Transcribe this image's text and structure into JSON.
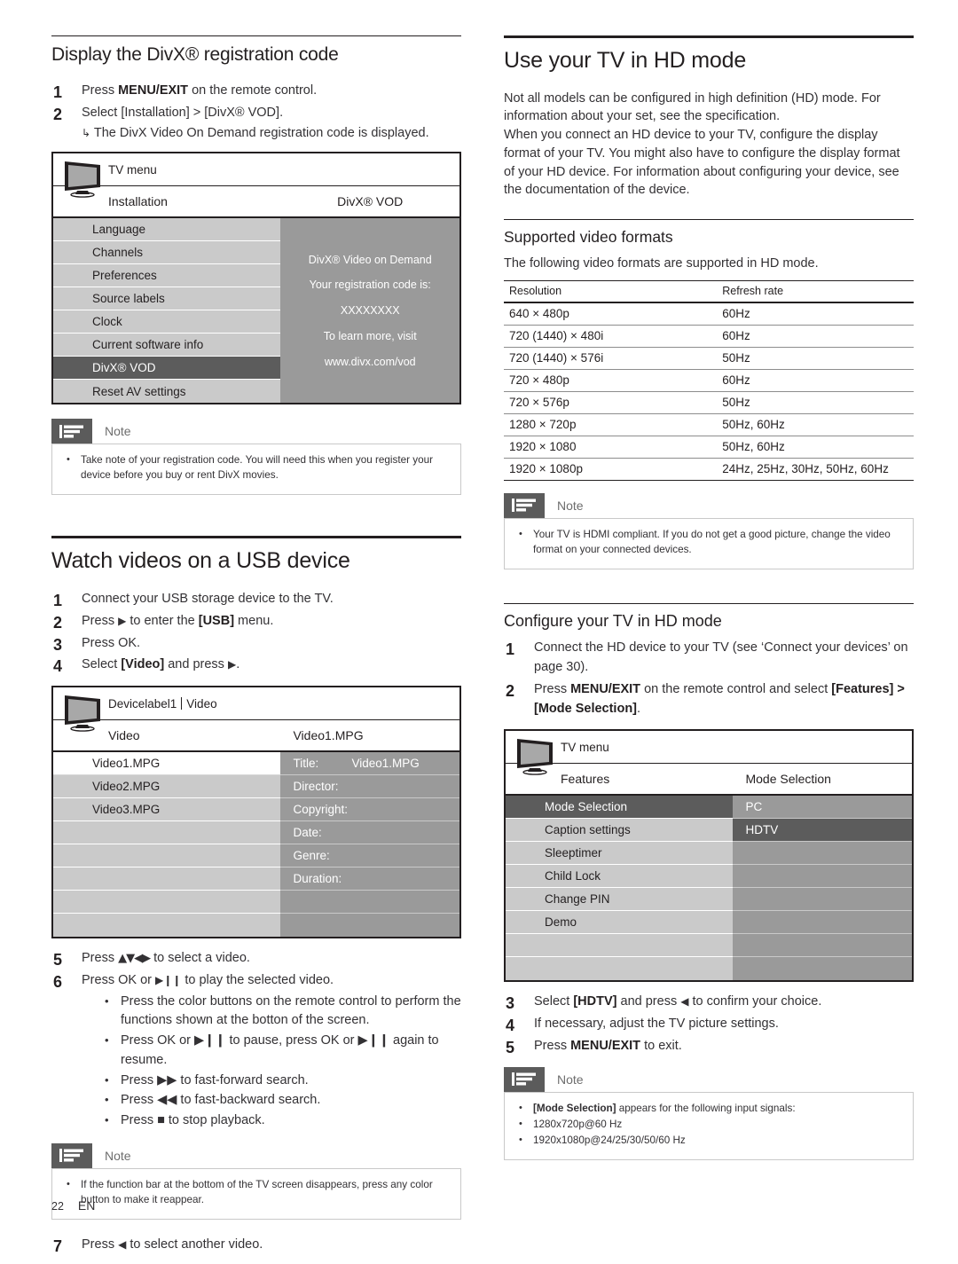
{
  "left": {
    "divx": {
      "heading": "Display the DivX® registration code",
      "steps": [
        {
          "num": "1",
          "text_before": "Press ",
          "bold": "MENU/EXIT",
          "text_after": " on the remote control."
        },
        {
          "num": "2",
          "text_before": "Select ",
          "bold": "[Installation] > [DivX® VOD]",
          "text_after": "."
        }
      ],
      "substep": "The DivX Video On Demand registration code is displayed.",
      "menu": {
        "titlebar": "TV menu",
        "col1_header": "Installation",
        "col2_header": "DivX® VOD",
        "items": [
          {
            "label": "Language",
            "selected": false
          },
          {
            "label": "Channels",
            "selected": false
          },
          {
            "label": "Preferences",
            "selected": false
          },
          {
            "label": "Source labels",
            "selected": false
          },
          {
            "label": "Clock",
            "selected": false
          },
          {
            "label": "Current software info",
            "selected": false
          },
          {
            "label": "DivX® VOD",
            "selected": true
          },
          {
            "label": "Reset AV settings",
            "selected": false
          }
        ],
        "panel_lines": [
          "DivX® Video on Demand",
          "Your registration code is: XXXXXXXX",
          "To learn more, visit www.divx.com/vod"
        ]
      },
      "note": {
        "label": "Note",
        "bullets": [
          "Take note of your registration code. You will need this when you register your device before you buy or rent DivX movies."
        ]
      }
    },
    "usb": {
      "heading": "Watch videos on a USB device",
      "steps": [
        {
          "num": "1",
          "text": "Connect your USB storage device to the TV."
        },
        {
          "num": "2",
          "text_before": "Press ",
          "glyph": "▶",
          "text_mid": " to enter the ",
          "bold": "[USB]",
          "text_after": " menu."
        },
        {
          "num": "3",
          "text_before": "Press ",
          "bold": "OK",
          "text_after": "."
        },
        {
          "num": "4",
          "text_before": "Select ",
          "bold": "[Video]",
          "text_mid": " and press ",
          "glyph": "▶",
          "text_after": "."
        }
      ],
      "menu": {
        "titlebar_device": "Devicelabel1",
        "titlebar_section": "Video",
        "col1_header": "Video",
        "col2_header": "Video1.MPG",
        "items": [
          {
            "label": "Video1.MPG",
            "highlight": true
          },
          {
            "label": "Video2.MPG",
            "highlight": false
          },
          {
            "label": "Video3.MPG",
            "highlight": false
          },
          {
            "label": "",
            "highlight": false
          },
          {
            "label": "",
            "highlight": false
          },
          {
            "label": "",
            "highlight": false
          },
          {
            "label": "",
            "highlight": false
          },
          {
            "label": "",
            "highlight": false
          }
        ],
        "details": [
          {
            "key": "Title:",
            "value": "Video1.MPG"
          },
          {
            "key": "Director:",
            "value": ""
          },
          {
            "key": "Copyright:",
            "value": ""
          },
          {
            "key": "Date:",
            "value": ""
          },
          {
            "key": "Genre:",
            "value": ""
          },
          {
            "key": "Duration:",
            "value": ""
          },
          {
            "key": "",
            "value": ""
          },
          {
            "key": "",
            "value": ""
          }
        ]
      },
      "steps2": [
        {
          "num": "5",
          "text_before": "Press ",
          "glyph": "▲▼◀▶",
          "text_after": " to select a video."
        },
        {
          "num": "6",
          "text_before": "Press ",
          "bold": "OK",
          "text_mid": " or ",
          "glyph": "▶❙❙",
          "text_after": " to play the selected video."
        }
      ],
      "bullets": [
        "Press the color buttons on the remote control to perform the functions shown at the botton of the screen.",
        "Press OK or ▶❙❙ to pause, press OK or ▶❙❙ again to resume.",
        "Press ▶▶ to fast-forward search.",
        "Press ◀◀ to fast-backward search.",
        "Press ■ to stop playback."
      ],
      "note": {
        "label": "Note",
        "bullets": [
          "If the function bar at the bottom of the TV screen disappears, press any color button to make it reappear."
        ]
      },
      "step7": {
        "num": "7",
        "text_before": "Press ",
        "glyph": "◀",
        "text_after": " to select another video."
      }
    }
  },
  "right": {
    "hd": {
      "heading": "Use your TV in HD mode",
      "paragraphs": [
        "Not all models can be configured in high definition (HD) mode. For information about your set, see the specification.",
        "When you connect an HD device to your TV, configure the display format of your TV. You might also have to configure the display format of your HD device. For information about configuring your device, see the documentation of the device."
      ]
    },
    "formats": {
      "heading": "Supported video formats",
      "intro": "The following video formats are supported in HD mode.",
      "note": {
        "label": "Note",
        "bullets": [
          "Your TV is HDMI compliant. If you do not get a good picture, change the video format on your connected devices."
        ]
      }
    },
    "configure": {
      "heading": "Configure your TV in HD mode",
      "steps": [
        {
          "num": "1",
          "text": "Connect the HD device to your TV (see ‘Connect your devices’ on page 30)."
        },
        {
          "num": "2",
          "text_before": "Press ",
          "bold": "MENU/EXIT",
          "text_mid": " on the remote control and select ",
          "bold2": "[Features] > [Mode Selection]",
          "text_after": "."
        }
      ],
      "menu": {
        "titlebar": "TV menu",
        "col1_header": "Features",
        "col2_header": "Mode Selection",
        "items": [
          {
            "label": "Mode Selection",
            "selected": true
          },
          {
            "label": "Caption settings",
            "selected": false
          },
          {
            "label": "Sleeptimer",
            "selected": false
          },
          {
            "label": "Child Lock",
            "selected": false
          },
          {
            "label": "Change PIN",
            "selected": false
          },
          {
            "label": "Demo",
            "selected": false
          },
          {
            "label": "",
            "selected": false
          },
          {
            "label": "",
            "selected": false
          }
        ],
        "options": [
          {
            "label": "PC",
            "selected": false
          },
          {
            "label": "HDTV",
            "selected": true
          },
          {
            "label": "",
            "selected": false
          },
          {
            "label": "",
            "selected": false
          },
          {
            "label": "",
            "selected": false
          },
          {
            "label": "",
            "selected": false
          },
          {
            "label": "",
            "selected": false
          },
          {
            "label": "",
            "selected": false
          }
        ]
      },
      "steps2": [
        {
          "num": "3",
          "text_before": "Select ",
          "bold": "[HDTV]",
          "text_mid": " and press ",
          "glyph": "◀",
          "text_after": " to confirm your choice."
        },
        {
          "num": "4",
          "text": "If necessary, adjust the TV picture settings."
        },
        {
          "num": "5",
          "text_before": "Press ",
          "bold": "MENU/EXIT",
          "text_after": " to exit."
        }
      ],
      "note": {
        "label": "Note",
        "bullets": [
          "[Mode Selection] appears for the following input signals:",
          "1280x720p@60 Hz",
          "1920x1080p@24/25/30/50/60 Hz"
        ],
        "first_bold_prefix": "[Mode Selection]"
      }
    }
  },
  "footer": {
    "page": "22",
    "lang": "EN"
  },
  "chart_data": {
    "type": "table",
    "title": "Supported video formats",
    "columns": [
      "Resolution",
      "Refresh rate"
    ],
    "rows": [
      [
        "640 × 480p",
        "60Hz"
      ],
      [
        "720 (1440) × 480i",
        "60Hz"
      ],
      [
        "720 (1440) × 576i",
        "50Hz"
      ],
      [
        "720 × 480p",
        "60Hz"
      ],
      [
        "720 × 576p",
        "50Hz"
      ],
      [
        "1280 × 720p",
        "50Hz, 60Hz"
      ],
      [
        "1920 × 1080",
        "50Hz, 60Hz"
      ],
      [
        "1920 × 1080p",
        "24Hz, 25Hz, 30Hz, 50Hz, 60Hz"
      ]
    ]
  },
  "colors": {
    "ink": "#231f20",
    "menu_row": "#cacaca",
    "menu_selected": "#5c5c5c",
    "panel_gray": "#9a9a9a",
    "note_tab": "#5b5b5b"
  }
}
